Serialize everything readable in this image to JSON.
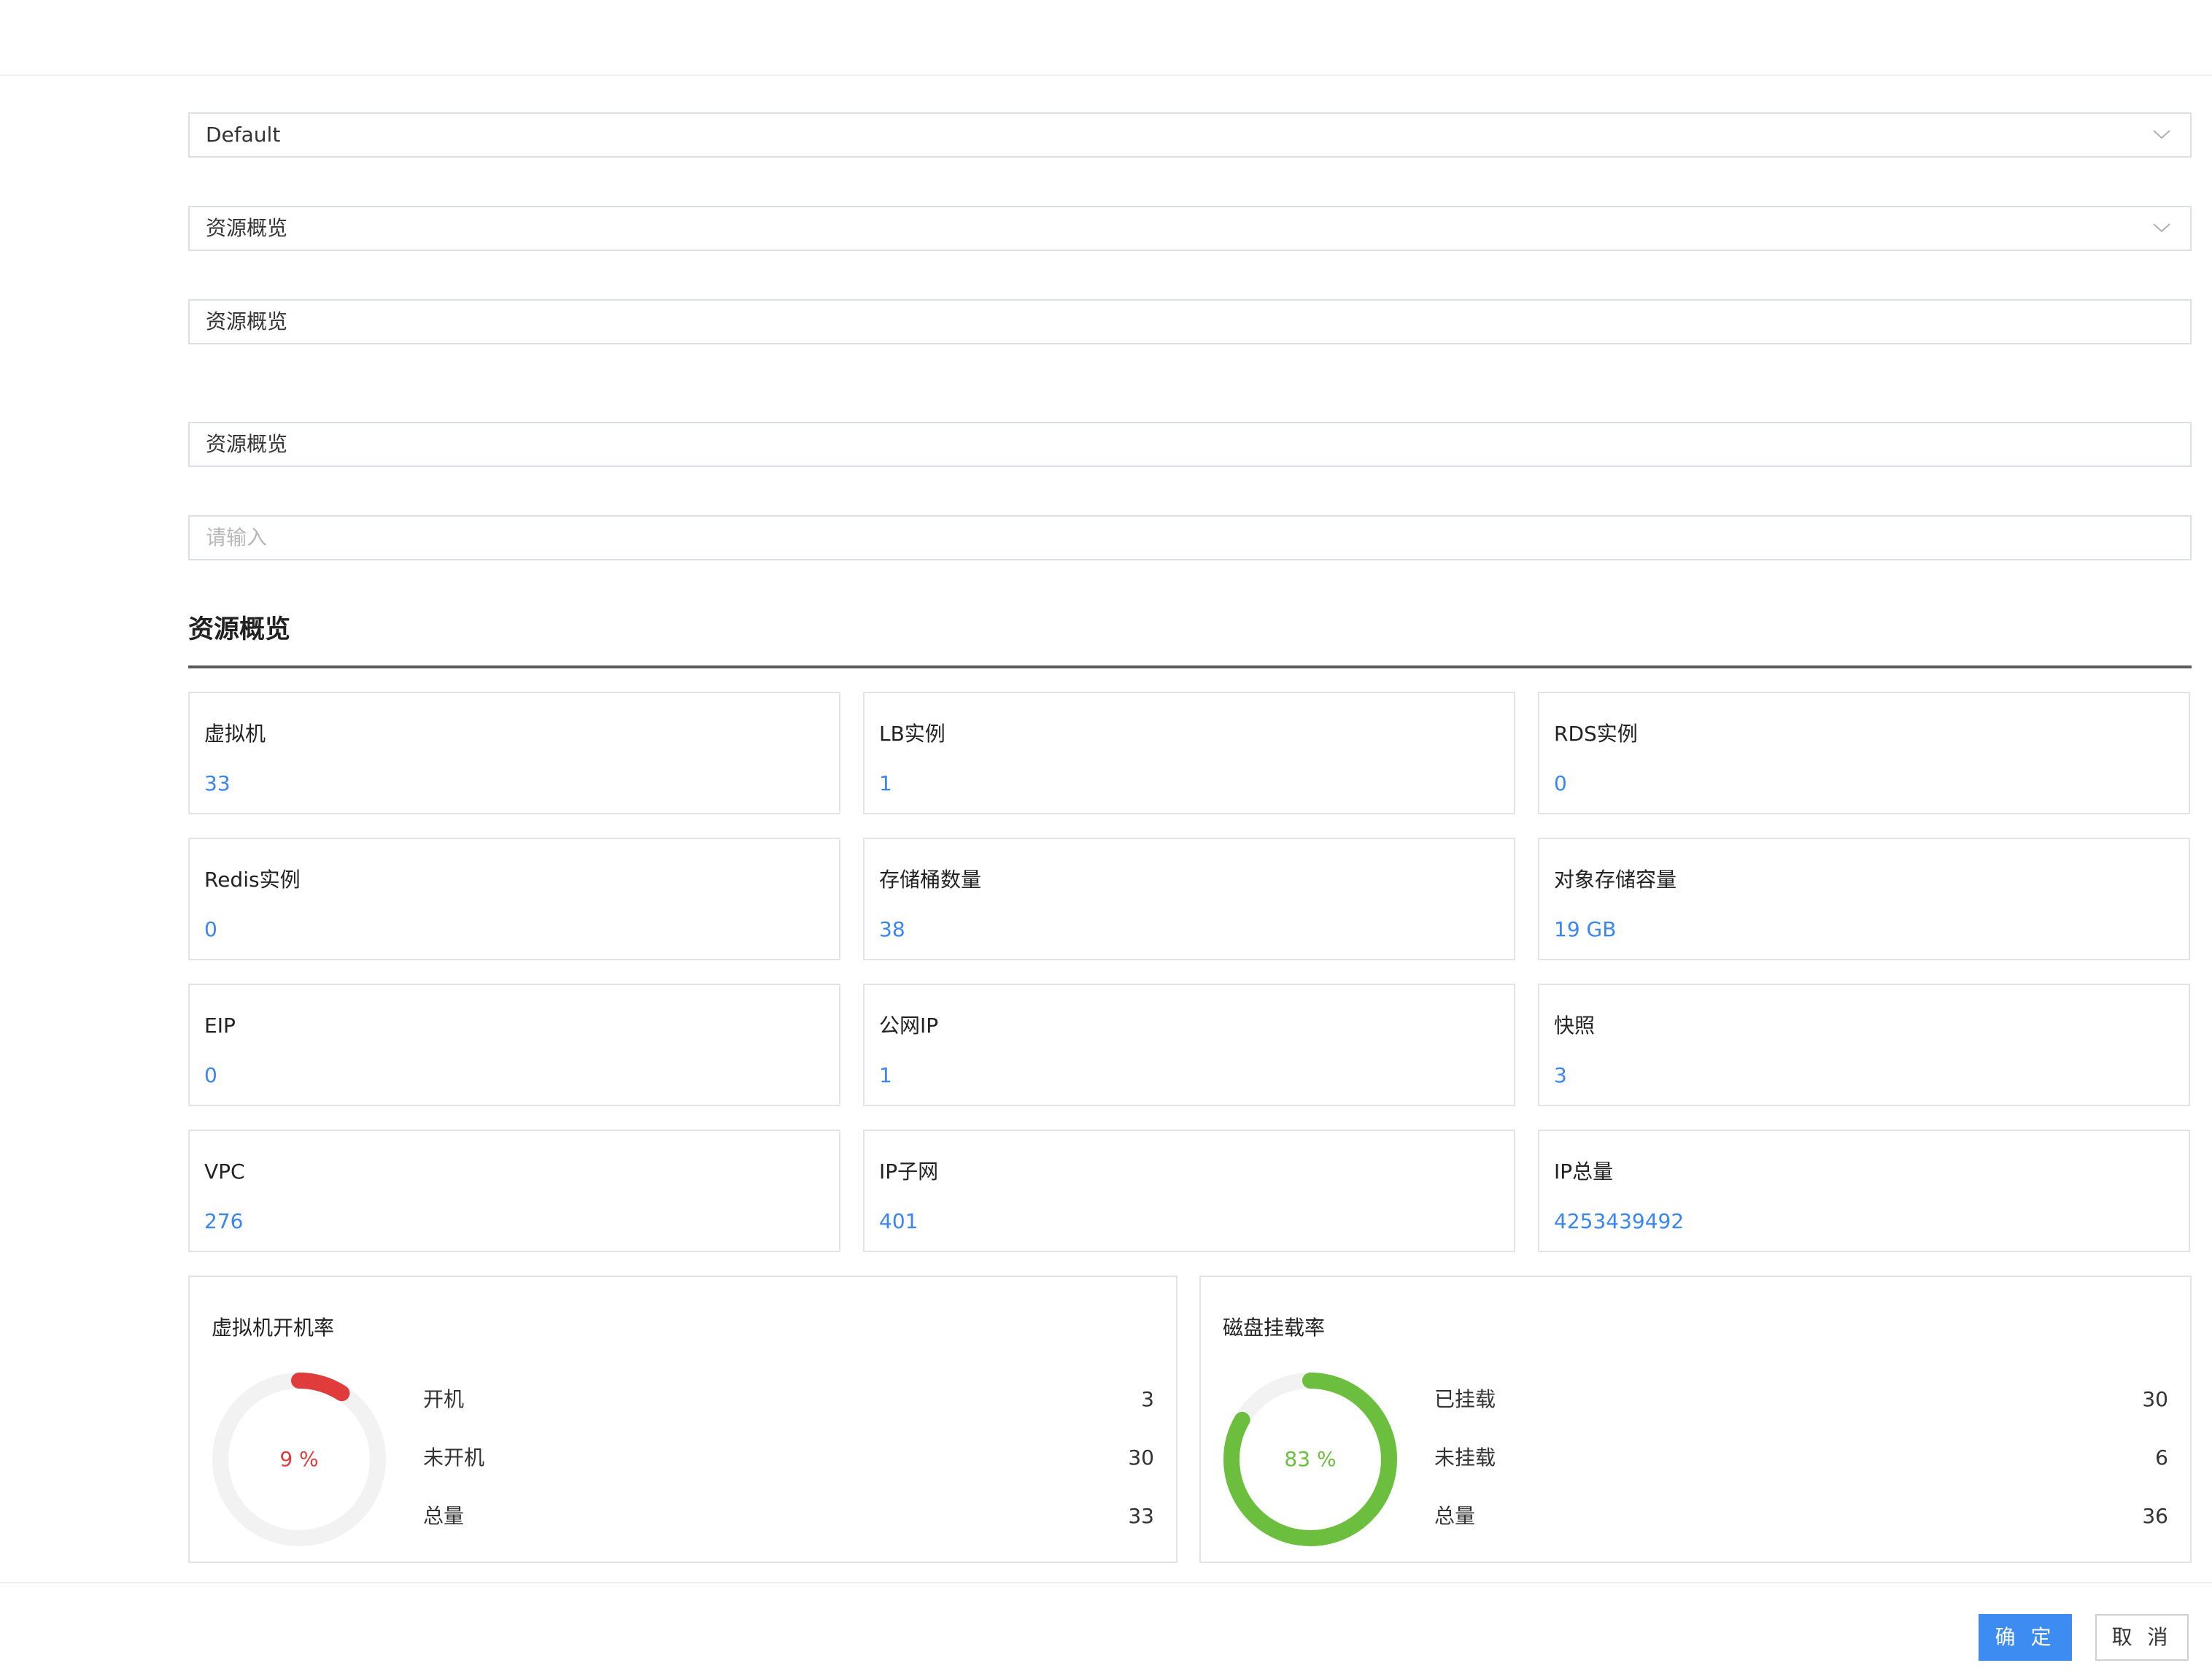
{
  "form": {
    "project_select": {
      "value": "Default"
    },
    "dashboard_select": {
      "value": "资源概览"
    },
    "name_input": {
      "value": "资源概览"
    },
    "title_input": {
      "value": "资源概览"
    },
    "extra_input": {
      "placeholder": "请输入"
    }
  },
  "section": {
    "title": "资源概览"
  },
  "stats": [
    {
      "label": "虚拟机",
      "value": "33"
    },
    {
      "label": "LB实例",
      "value": "1"
    },
    {
      "label": "RDS实例",
      "value": "0"
    },
    {
      "label": "Redis实例",
      "value": "0"
    },
    {
      "label": "存储桶数量",
      "value": "38"
    },
    {
      "label": "对象存储容量",
      "value": "19 GB"
    },
    {
      "label": "EIP",
      "value": "0"
    },
    {
      "label": "公网IP",
      "value": "1"
    },
    {
      "label": "快照",
      "value": "3"
    },
    {
      "label": "VPC",
      "value": "276"
    },
    {
      "label": "IP子网",
      "value": "401"
    },
    {
      "label": "IP总量",
      "value": "4253439492"
    }
  ],
  "vm_rate": {
    "title": "虚拟机开机率",
    "percent_label": "9 %",
    "fraction": 0.0909,
    "color": "#e03c3c",
    "rows": [
      {
        "label": "开机",
        "value": "3"
      },
      {
        "label": "未开机",
        "value": "30"
      },
      {
        "label": "总量",
        "value": "33"
      }
    ]
  },
  "disk_rate": {
    "title": "磁盘挂载率",
    "percent_label": "83 %",
    "fraction": 0.8333,
    "color": "#6cbf3e",
    "rows": [
      {
        "label": "已挂载",
        "value": "30"
      },
      {
        "label": "未挂载",
        "value": "6"
      },
      {
        "label": "总量",
        "value": "36"
      }
    ]
  },
  "buttons": {
    "confirm": "确 定",
    "cancel": "取 消"
  },
  "colors": {
    "accent": "#3c8cf2",
    "value_text": "#3a86f0",
    "donut_track": "#f2f2f2"
  }
}
